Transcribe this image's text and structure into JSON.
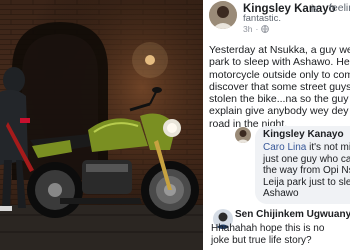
{
  "post": {
    "author": "Kingsley Kanayo",
    "status_is": "is",
    "status_feeling": "feelin",
    "status_feeling_2": "fantastic.",
    "time": "3h",
    "privacy_icon": "globe-icon",
    "text_lines": [
      "Yesterday at Nsukka, a guy went to",
      "park to sleep with Ashawo. He left",
      "motorcycle outside only to come",
      "discover that some street guys ha",
      "stolen the bike...na so the guy con",
      "explain give anybody wey dey pas",
      "road in the night."
    ]
  },
  "comments": [
    {
      "author": "Kingsley Kanayo",
      "mention": "Caro Lina",
      "text_first": "it's not mine",
      "text_lines": [
        "just one guy who cam",
        "the way from Opi Nsu",
        "Leija park just to slee",
        "Ashawo"
      ]
    },
    {
      "author": "Sen Chijinkem Ugwuanyi",
      "text_lines": [
        "Hhahahah hope this is no",
        "joke but true life story?"
      ]
    }
  ],
  "colors": {
    "name": "#1c1e21",
    "muted": "#606770",
    "bubble": "#f0f2f5",
    "mention": "#385898",
    "motorcycle": "#7a8f22"
  }
}
